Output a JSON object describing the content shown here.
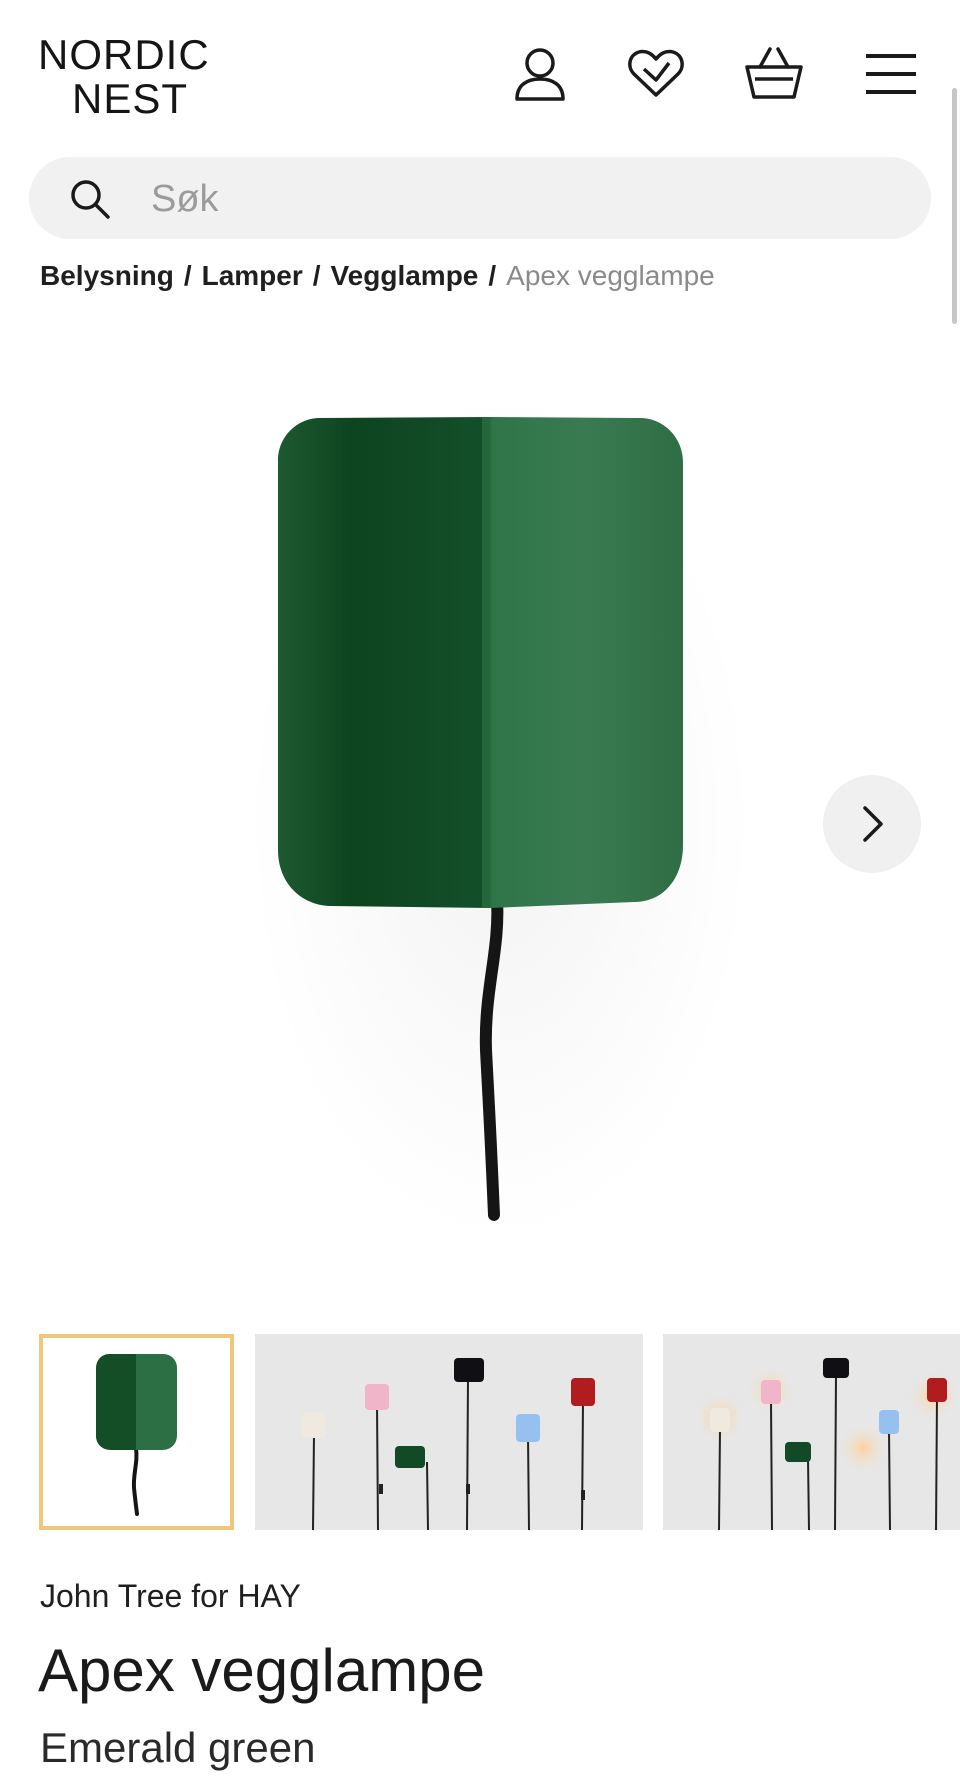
{
  "header": {
    "logo_line1": "NORDIC",
    "logo_line2": "NEST",
    "icons": [
      "user-icon",
      "heart-icon",
      "basket-icon",
      "menu-icon"
    ]
  },
  "search": {
    "placeholder": "Søk"
  },
  "breadcrumb": {
    "items": [
      "Belysning",
      "Lamper",
      "Vegglampe"
    ],
    "separator": "/",
    "current": "Apex vegglampe"
  },
  "gallery": {
    "next_icon": "chevron-right-icon",
    "selected_thumb_index": 0,
    "thumb_count_visible": 3
  },
  "product": {
    "designer": "John Tree",
    "for_label": "for",
    "brand": "HAY",
    "title": "Apex vegglampe",
    "variant": "Emerald green"
  },
  "colors": {
    "lamp_green": "#1f5f33",
    "thumb_active_border": "#f3c778",
    "search_bg": "#f1f1f1",
    "breadcrumb_current": "#8a8a8a"
  }
}
